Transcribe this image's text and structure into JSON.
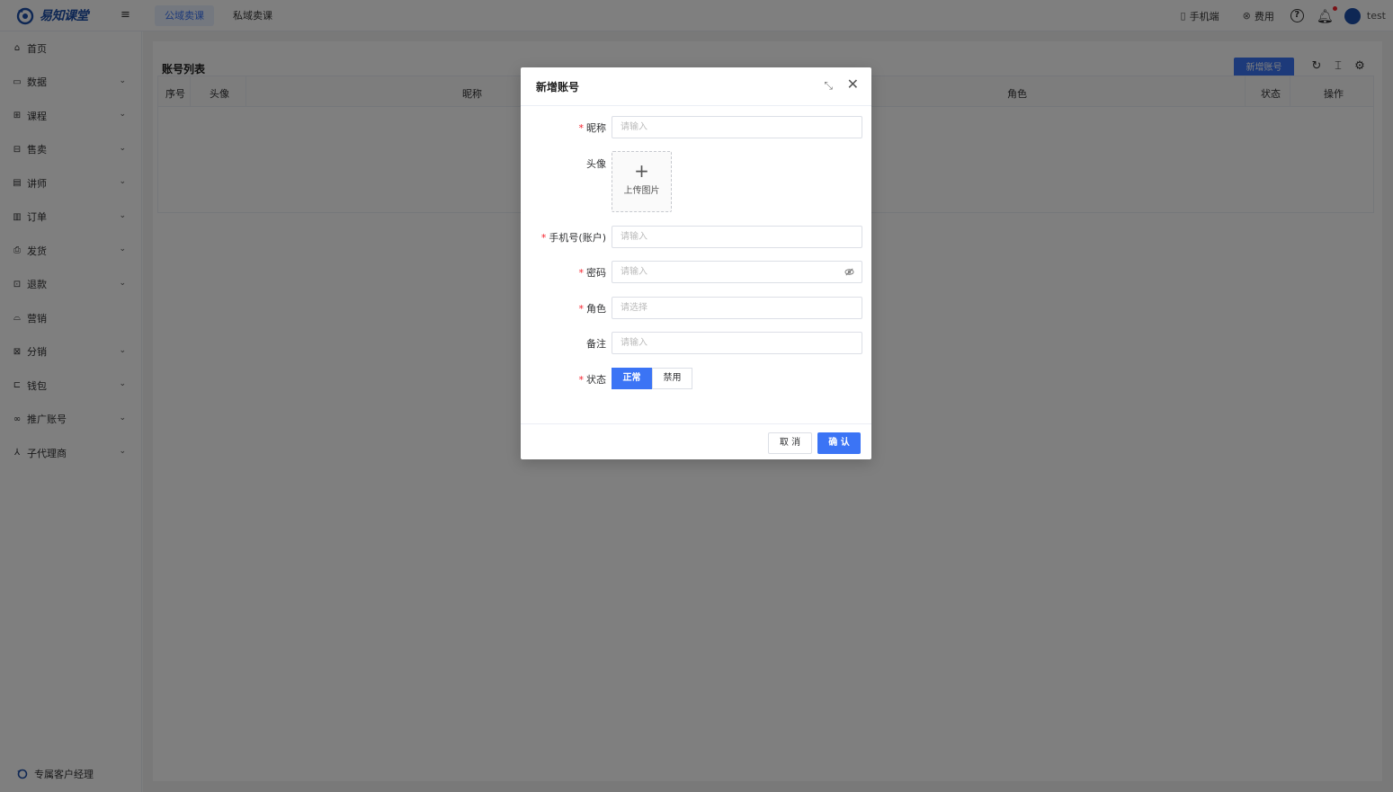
{
  "app": {
    "logo_text": "易知课堂",
    "username": "test"
  },
  "topnav": {
    "tabs": [
      {
        "label": "公域卖课"
      },
      {
        "label": "私域卖课"
      }
    ]
  },
  "topright": {
    "mobile_label": "手机端",
    "fee_label": "费用"
  },
  "sidebar": {
    "items": [
      {
        "label": "首页",
        "icon": "home-icon"
      },
      {
        "label": "数据",
        "icon": "chart-icon"
      },
      {
        "label": "课程",
        "icon": "grid-icon"
      },
      {
        "label": "售卖",
        "icon": "store-icon"
      },
      {
        "label": "讲师",
        "icon": "lecturer-icon"
      },
      {
        "label": "订单",
        "icon": "order-icon"
      },
      {
        "label": "发货",
        "icon": "printer-icon"
      },
      {
        "label": "退款",
        "icon": "refund-icon"
      },
      {
        "label": "营销",
        "icon": "bag-icon"
      },
      {
        "label": "分销",
        "icon": "share-icon"
      },
      {
        "label": "钱包",
        "icon": "wallet-icon"
      },
      {
        "label": "推广账号",
        "icon": "link-icon"
      },
      {
        "label": "子代理商",
        "icon": "agent-icon"
      }
    ],
    "footer_label": "专属客户经理"
  },
  "main": {
    "title": "账号列表",
    "add_button": "新增账号",
    "columns": [
      "序号",
      "头像",
      "昵称",
      "角色",
      "状态",
      "操作"
    ]
  },
  "dialog": {
    "title": "新增账号",
    "fields": {
      "nickname": {
        "label": "昵称",
        "placeholder": "请输入"
      },
      "avatar": {
        "label": "头像",
        "upload_text": "上传图片"
      },
      "phone": {
        "label": "手机号(账户)",
        "placeholder": "请输入"
      },
      "password": {
        "label": "密码",
        "placeholder": "请输入"
      },
      "role": {
        "label": "角色",
        "placeholder": "请选择"
      },
      "remark": {
        "label": "备注",
        "placeholder": "请输入"
      },
      "status": {
        "label": "状态",
        "options": [
          "正常",
          "禁用"
        ],
        "selected": "正常"
      }
    },
    "cancel_label": "取 消",
    "ok_label": "确 认"
  },
  "colors": {
    "accent": "#3b74f5",
    "brand": "#1d4ea8",
    "required": "#f5222d"
  }
}
